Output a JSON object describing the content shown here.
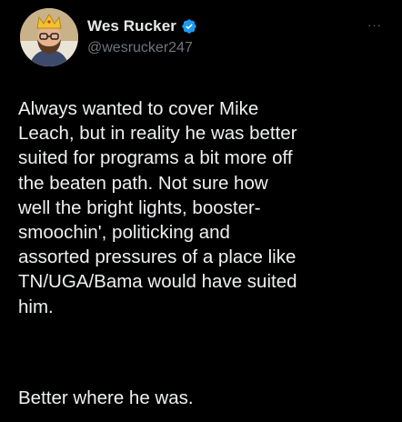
{
  "tweet": {
    "author": {
      "display_name": "Wes Rucker",
      "handle": "@wesrucker247",
      "verified_icon": "verified-badge-icon",
      "avatar_icon": "avatar"
    },
    "more_icon": "more-options-icon",
    "more_label": "···",
    "text_paragraph_1": "Always wanted to cover Mike\nLeach, but in reality he was better\nsuited for programs a bit more off\nthe beaten path. Not sure how\nwell the bright lights, booster-\nsmoochin', politicking and\nassorted pressures of a place like\nTN/UGA/Bama would have suited\nhim.",
    "text_paragraph_2": "Better where he was.",
    "colors": {
      "background": "#000000",
      "text": "#e7e9ea",
      "secondary": "#71767b",
      "verified": "#1d9bf0"
    }
  }
}
